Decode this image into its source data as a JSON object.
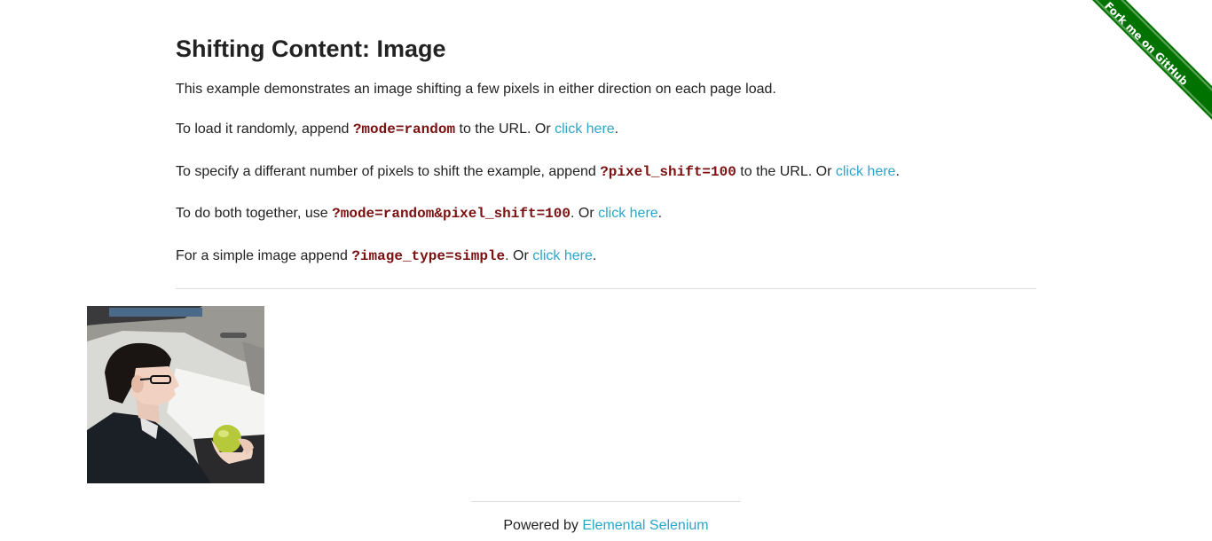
{
  "header": {
    "title": "Shifting Content: Image"
  },
  "intro": {
    "text": "This example demonstrates an image shifting a few pixels in either direction on each page load."
  },
  "random": {
    "prefix": "To load it randomly, append ",
    "code": "?mode=random",
    "middle": " to the URL. Or ",
    "link": "click here",
    "suffix": "."
  },
  "pixel_shift": {
    "prefix": "To specify a differant number of pixels to shift the example, append ",
    "code": "?pixel_shift=100",
    "middle": " to the URL. Or ",
    "link": "click here",
    "suffix": "."
  },
  "both": {
    "prefix": "To do both together, use ",
    "code": "?mode=random&pixel_shift=100",
    "middle": ". Or ",
    "link": "click here",
    "suffix": "."
  },
  "simple": {
    "prefix": "For a simple image append ",
    "code": "?image_type=simple",
    "middle": ". Or ",
    "link": "click here",
    "suffix": "."
  },
  "footer": {
    "prefix": "Powered by ",
    "link": "Elemental Selenium"
  },
  "ribbon": {
    "text": "Fork me on GitHub",
    "color": "#007200"
  },
  "colors": {
    "link": "#2ba6cb",
    "code": "#7a1010"
  }
}
